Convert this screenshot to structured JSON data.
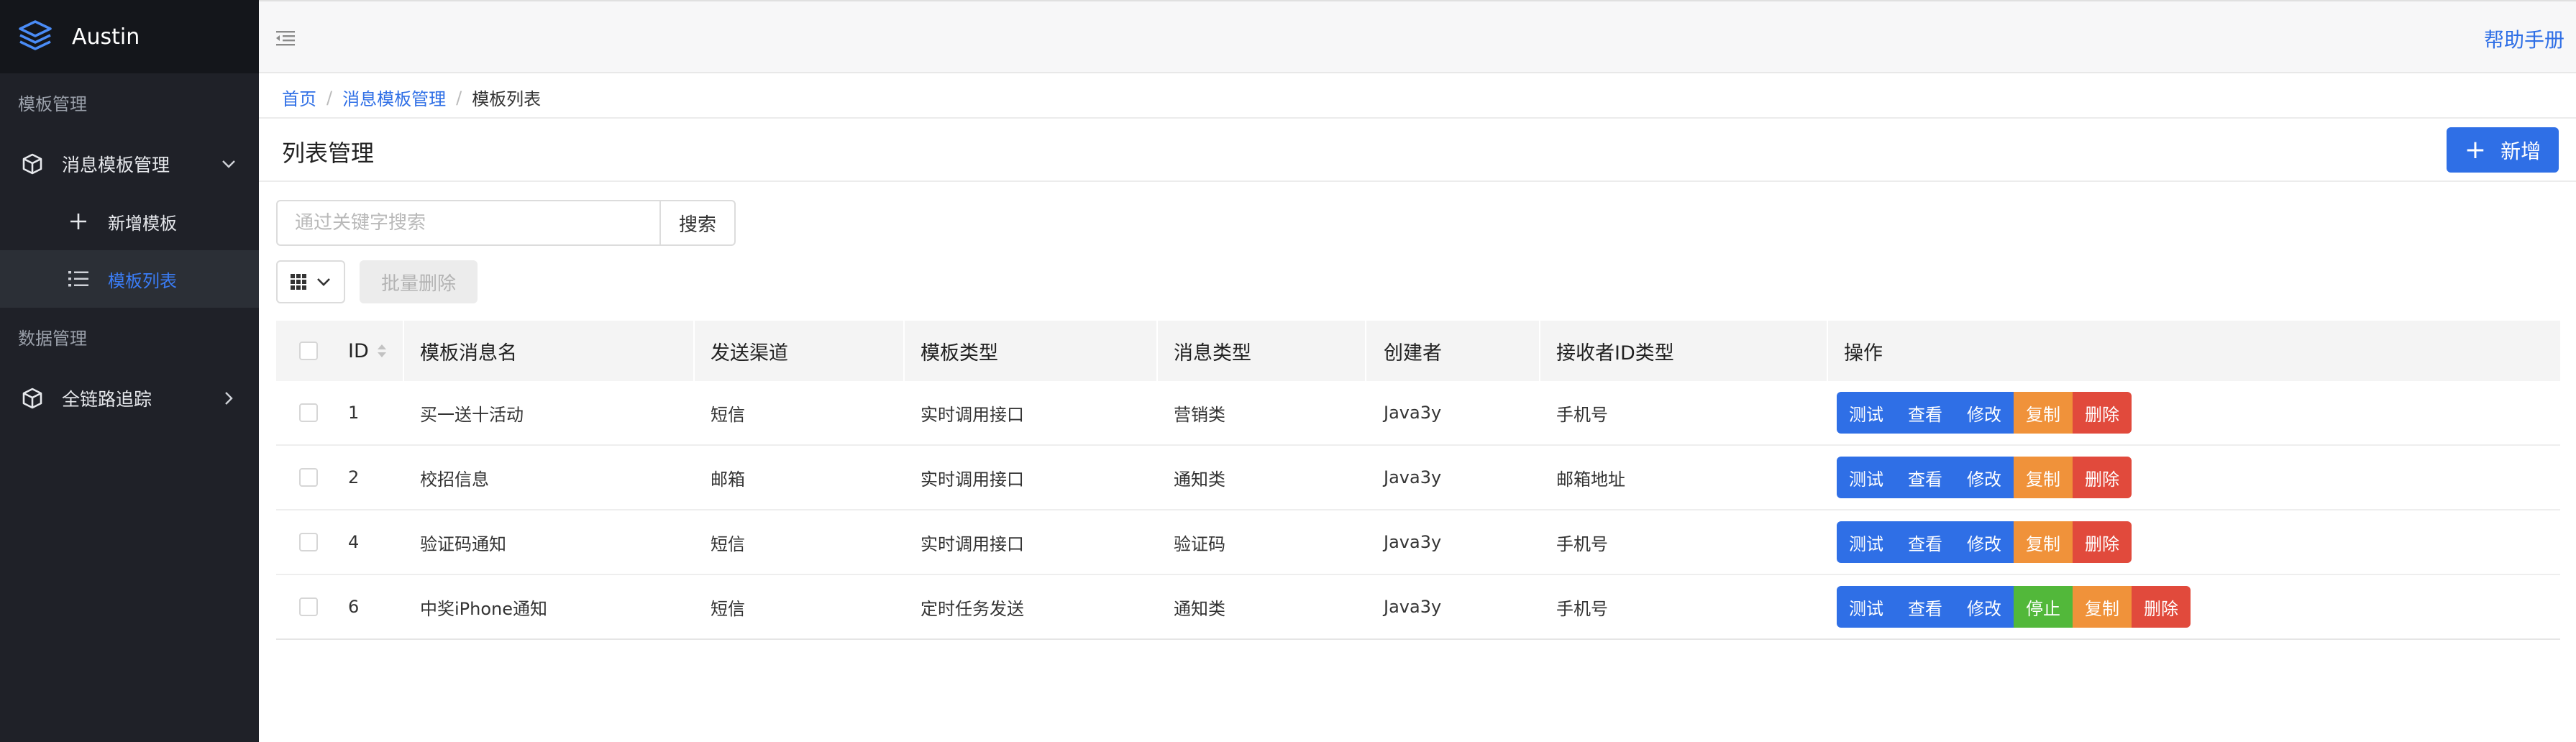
{
  "brand": {
    "name": "Austin"
  },
  "sidebar": {
    "group1": "模板管理",
    "template_menu": {
      "label": "消息模板管理"
    },
    "sub_items": [
      {
        "label": "新增模板"
      },
      {
        "label": "模板列表"
      }
    ],
    "group2": "数据管理",
    "trace_menu": {
      "label": "全链路追踪"
    }
  },
  "header": {
    "help": "帮助手册"
  },
  "breadcrumb": {
    "home": "首页",
    "parent": "消息模板管理",
    "current": "模板列表"
  },
  "page": {
    "title": "列表管理",
    "add_label": "新增"
  },
  "search": {
    "placeholder": "通过关键字搜索",
    "value": "",
    "button": "搜索"
  },
  "toolbar": {
    "bulk_delete": "批量删除"
  },
  "table": {
    "headers": [
      "ID",
      "模板消息名",
      "发送渠道",
      "模板类型",
      "消息类型",
      "创建者",
      "接收者ID类型",
      "操作"
    ],
    "rows": [
      {
        "id": "1",
        "name": "买一送十活动",
        "channel": "短信",
        "template_type": "实时调用接口",
        "msg_type": "营销类",
        "creator": "Java3y",
        "receiver_type": "手机号",
        "ops": [
          "测试",
          "查看",
          "修改",
          "复制",
          "删除"
        ]
      },
      {
        "id": "2",
        "name": "校招信息",
        "channel": "邮箱",
        "template_type": "实时调用接口",
        "msg_type": "通知类",
        "creator": "Java3y",
        "receiver_type": "邮箱地址",
        "ops": [
          "测试",
          "查看",
          "修改",
          "复制",
          "删除"
        ]
      },
      {
        "id": "4",
        "name": "验证码通知",
        "channel": "短信",
        "template_type": "实时调用接口",
        "msg_type": "验证码",
        "creator": "Java3y",
        "receiver_type": "手机号",
        "ops": [
          "测试",
          "查看",
          "修改",
          "复制",
          "删除"
        ]
      },
      {
        "id": "6",
        "name": "中奖iPhone通知",
        "channel": "短信",
        "template_type": "定时任务发送",
        "msg_type": "通知类",
        "creator": "Java3y",
        "receiver_type": "手机号",
        "ops": [
          "测试",
          "查看",
          "修改",
          "停止",
          "复制",
          "删除"
        ]
      }
    ]
  },
  "colors": {
    "primary": "#2f6fe6",
    "warning": "#f0923a",
    "danger": "#e14a3c",
    "success": "#52b83a",
    "sidebar_bg": "#1f2128"
  }
}
